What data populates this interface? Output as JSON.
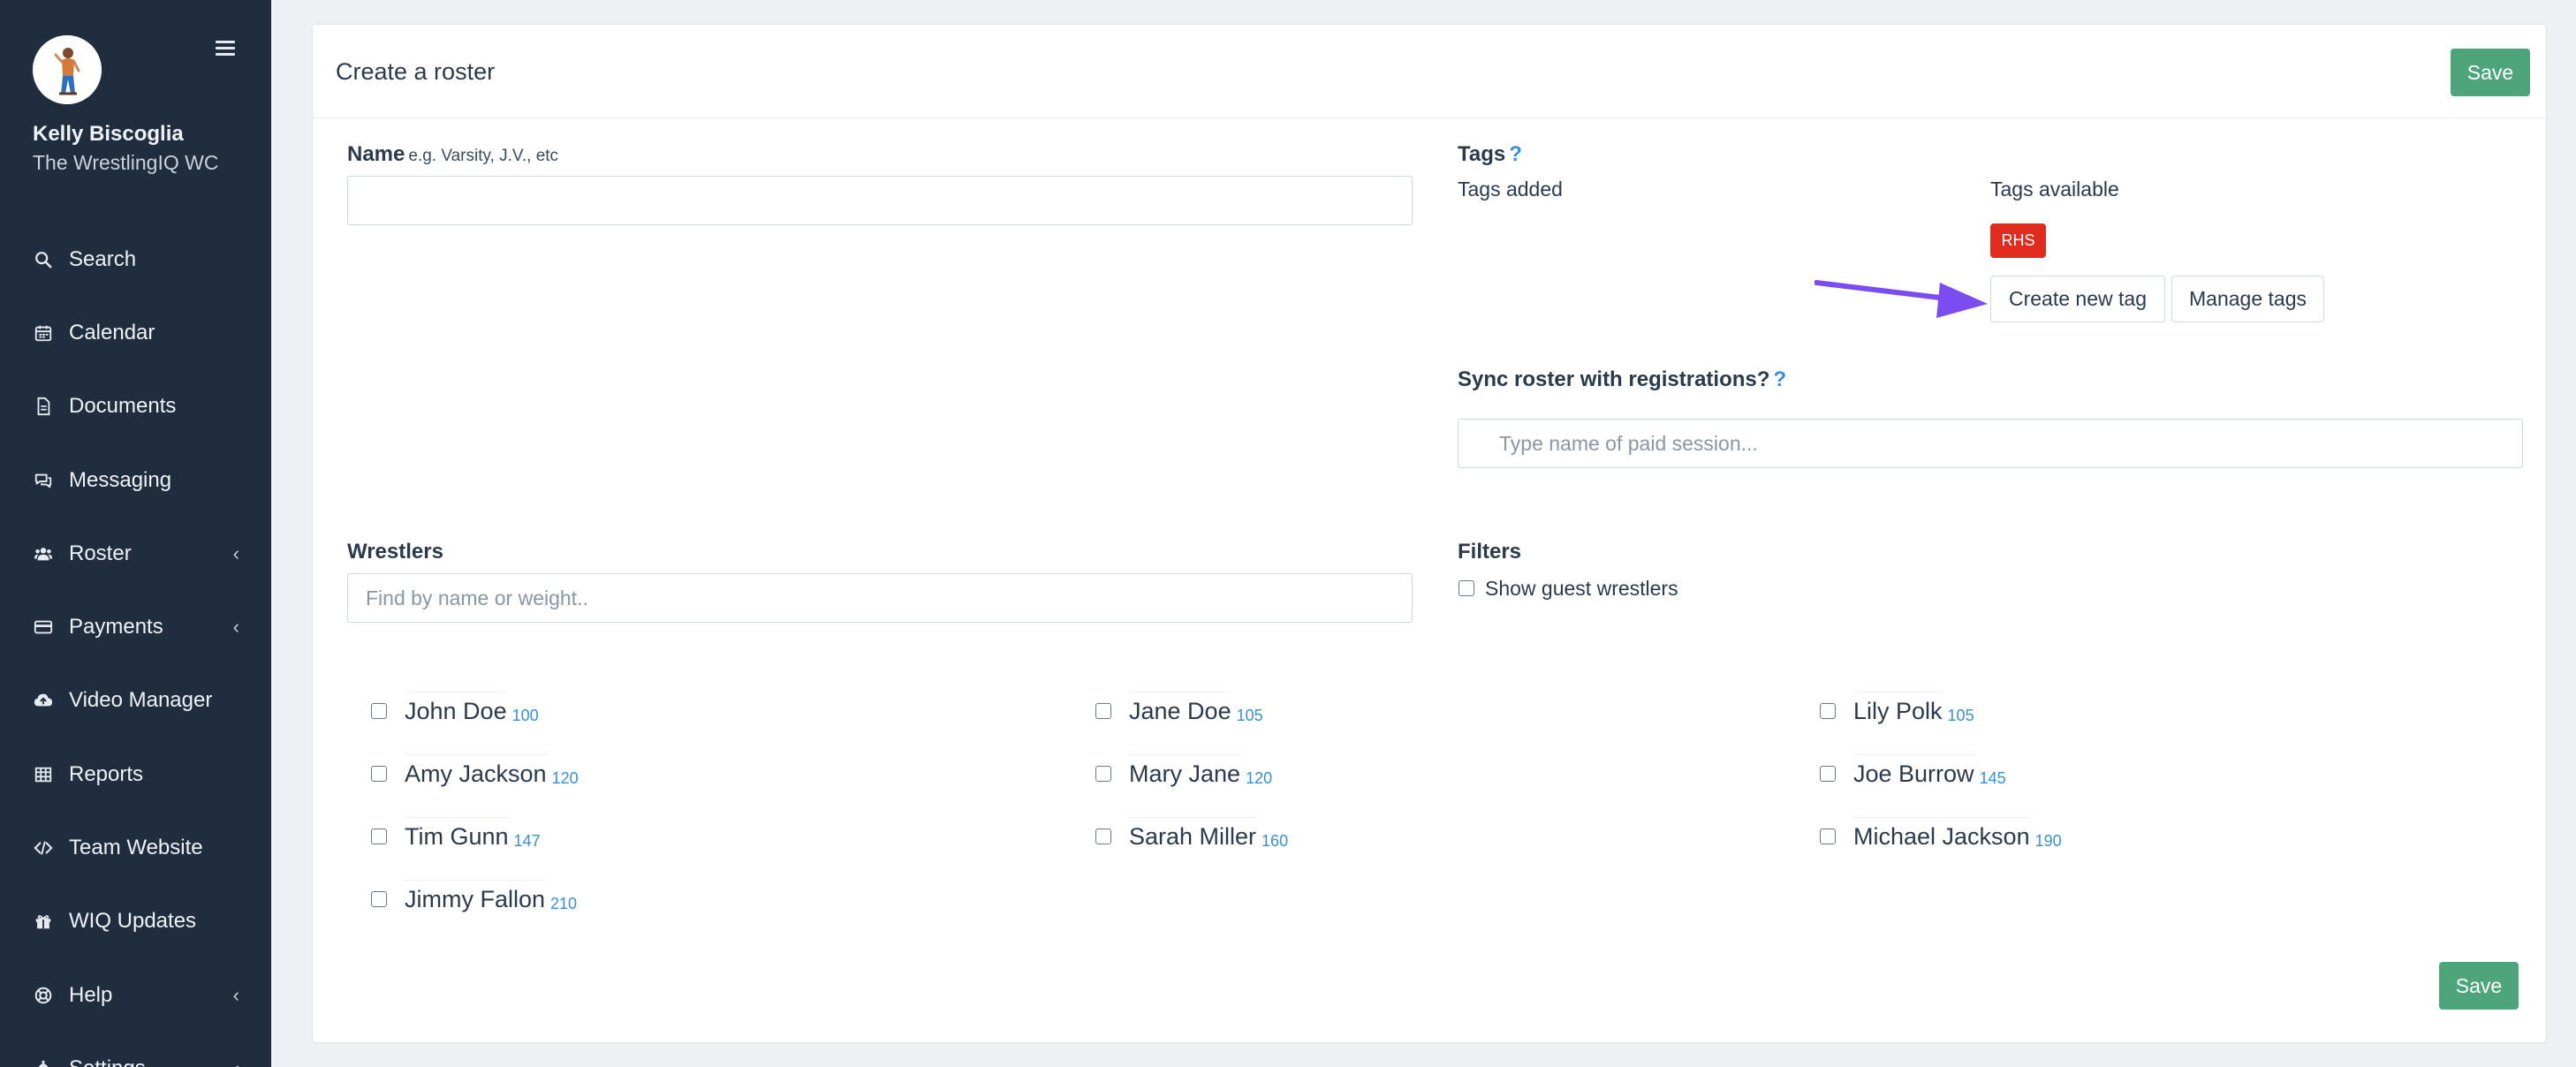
{
  "sidebar": {
    "user_name": "Kelly Biscoglia",
    "user_org": "The WrestlingIQ WC",
    "items": [
      {
        "label": "Search",
        "icon": "search-icon",
        "chevron": false
      },
      {
        "label": "Calendar",
        "icon": "calendar-icon",
        "chevron": false
      },
      {
        "label": "Documents",
        "icon": "document-icon",
        "chevron": false
      },
      {
        "label": "Messaging",
        "icon": "chat-icon",
        "chevron": false
      },
      {
        "label": "Roster",
        "icon": "users-icon",
        "chevron": true
      },
      {
        "label": "Payments",
        "icon": "credit-card-icon",
        "chevron": true
      },
      {
        "label": "Video Manager",
        "icon": "cloud-upload-icon",
        "chevron": false
      },
      {
        "label": "Reports",
        "icon": "table-icon",
        "chevron": false
      },
      {
        "label": "Team Website",
        "icon": "code-icon",
        "chevron": false
      },
      {
        "label": "WIQ Updates",
        "icon": "gift-icon",
        "chevron": false
      },
      {
        "label": "Help",
        "icon": "lifebuoy-icon",
        "chevron": true
      },
      {
        "label": "Settings",
        "icon": "gear-icon",
        "chevron": true
      }
    ],
    "chevron_glyph": "‹"
  },
  "page": {
    "title": "Create a roster",
    "save_label": "Save"
  },
  "name_field": {
    "label": "Name",
    "hint": "e.g. Varsity, J.V., etc",
    "value": ""
  },
  "tags": {
    "label": "Tags",
    "help": "?",
    "added_label": "Tags added",
    "available_label": "Tags available",
    "available": [
      "RHS"
    ],
    "create_label": "Create new tag",
    "manage_label": "Manage tags"
  },
  "sync": {
    "label": "Sync roster with registrations?",
    "help": "?",
    "placeholder": "Type name of paid session..."
  },
  "wrestlers": {
    "label": "Wrestlers",
    "placeholder": "Find by name or weight..",
    "list": [
      {
        "name": "John Doe",
        "weight": "100"
      },
      {
        "name": "Jane Doe",
        "weight": "105"
      },
      {
        "name": "Lily Polk",
        "weight": "105"
      },
      {
        "name": "Amy Jackson",
        "weight": "120"
      },
      {
        "name": "Mary Jane",
        "weight": "120"
      },
      {
        "name": "Joe Burrow",
        "weight": "145"
      },
      {
        "name": "Tim Gunn",
        "weight": "147"
      },
      {
        "name": "Sarah Miller",
        "weight": "160"
      },
      {
        "name": "Michael Jackson",
        "weight": "190"
      },
      {
        "name": "Jimmy Fallon",
        "weight": "210"
      }
    ]
  },
  "filters": {
    "label": "Filters",
    "show_guest_label": "Show guest wrestlers",
    "show_guest_checked": false
  },
  "colors": {
    "sidebar_bg": "#1f2d3f",
    "save_green": "#4ea57c",
    "tag_red": "#e02c1e",
    "link_blue": "#3a8fd1",
    "arrow_purple": "#7b4cf0"
  }
}
